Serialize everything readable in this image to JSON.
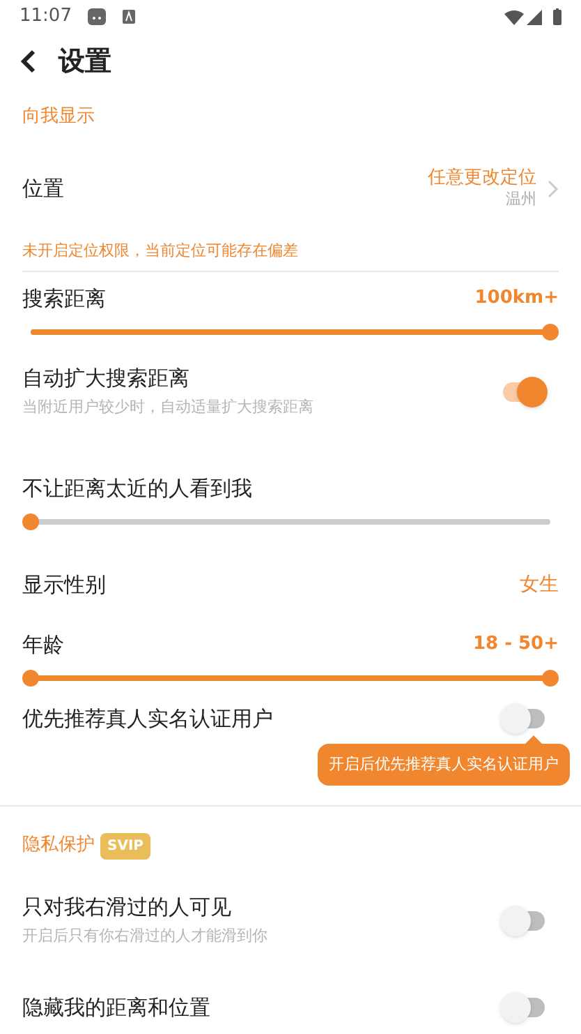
{
  "status_bar": {
    "time": "11:07"
  },
  "header": {
    "title": "设置"
  },
  "sections": [
    {
      "title": "向我显示",
      "items": [
        {
          "kind": "location",
          "label": "位置",
          "value": "任意更改定位",
          "sub_value": "温州",
          "note": "未开启定位权限，当前定位可能存在偏差"
        },
        {
          "kind": "slider",
          "label": "搜索距离",
          "value": "100km+",
          "level": 1
        },
        {
          "kind": "toggle",
          "label": "自动扩大搜索距离",
          "description": "当附近用户较少时，自动适量扩大搜索距离",
          "on": true
        },
        {
          "kind": "slider",
          "label": "不让距离太近的人看到我",
          "level": 0
        },
        {
          "kind": "value",
          "label": "显示性别",
          "value": "女生"
        },
        {
          "kind": "range",
          "label": "年龄",
          "value": "18 - 50+",
          "thumbs": [
            {
              "level": 0
            },
            {
              "level": 1
            }
          ]
        },
        {
          "kind": "toggle",
          "label": "优先推荐真人实名认证用户",
          "on": false,
          "tooltip": "开启后优先推荐真人实名认证用户"
        }
      ]
    },
    {
      "title": "隐私保护",
      "badge": "SVIP",
      "items": [
        {
          "kind": "toggle",
          "label": "只对我右滑过的人可见",
          "description": "开启后只有你右滑过的人才能滑到你",
          "on": false
        },
        {
          "kind": "toggle",
          "label": "隐藏我的距离和位置",
          "on": false
        }
      ]
    }
  ]
}
